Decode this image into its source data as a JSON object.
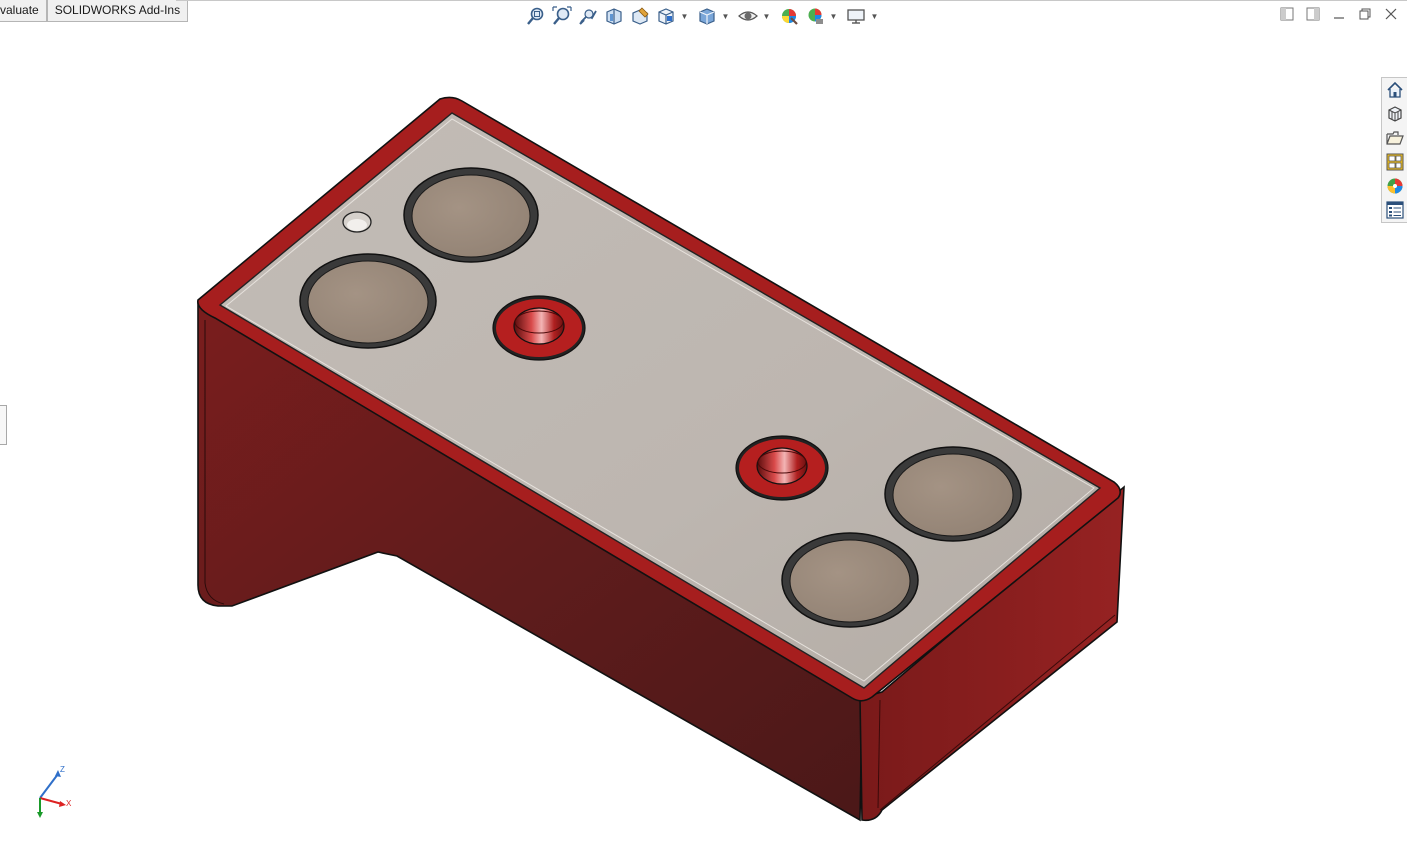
{
  "tabs": [
    {
      "label": "valuate"
    },
    {
      "label": "SOLIDWORKS Add-Ins"
    }
  ],
  "heads_up_toolbar": [
    {
      "icon": "zoom-to-fit-icon",
      "dropdown": false
    },
    {
      "icon": "zoom-to-area-icon",
      "dropdown": false
    },
    {
      "icon": "previous-view-icon",
      "dropdown": false
    },
    {
      "icon": "section-view-icon",
      "dropdown": false
    },
    {
      "icon": "dynamic-annotation-views-icon",
      "dropdown": false
    },
    {
      "icon": "view-orientation-icon",
      "dropdown": true
    },
    {
      "icon": "display-style-icon",
      "dropdown": true
    },
    {
      "icon": "hide-show-items-icon",
      "dropdown": true
    },
    {
      "icon": "edit-appearance-icon",
      "dropdown": false
    },
    {
      "icon": "apply-scene-icon",
      "dropdown": true
    },
    {
      "icon": "view-settings-icon",
      "dropdown": true
    }
  ],
  "window_controls": [
    "tile-left-icon",
    "tile-right-icon",
    "minimize-icon",
    "restore-icon",
    "close-icon"
  ],
  "task_pane": [
    "home-icon",
    "3d-resources-icon",
    "file-explorer-icon",
    "view-palette-icon",
    "appearances-icon",
    "custom-properties-icon"
  ],
  "triad": {
    "z": "Z",
    "x": "X"
  },
  "colors": {
    "body_red": "#8b1f1f",
    "body_dark": "#5e1c1c",
    "face_grey": "#bcb6b0",
    "hole_fill": "#9e8e80",
    "accent_blue": "#2f6fc9"
  }
}
